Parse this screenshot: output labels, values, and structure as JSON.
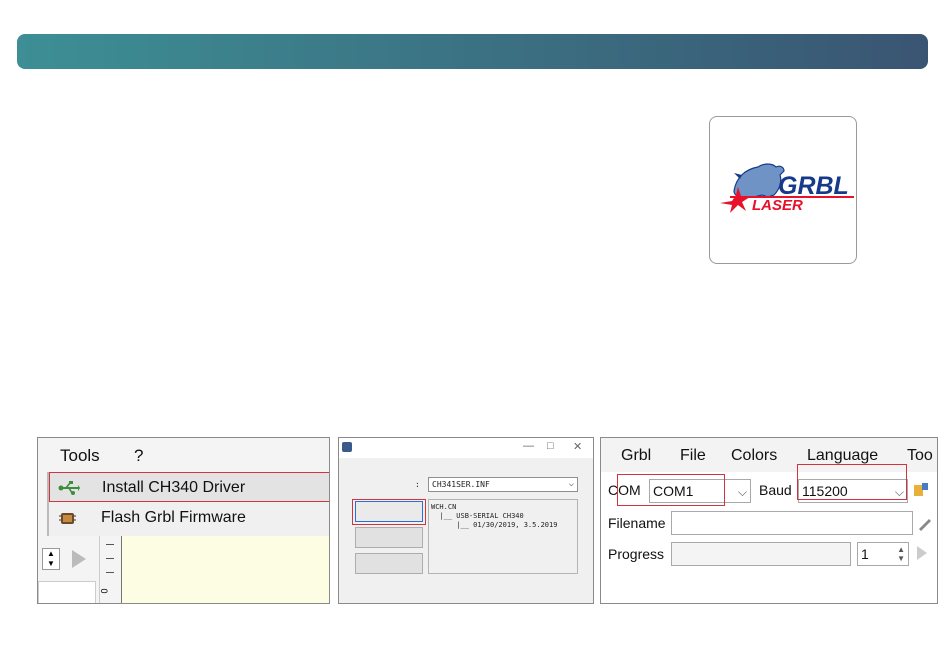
{
  "colors": {
    "header_start": "#3d8f95",
    "header_end": "#3a5573",
    "highlight": "#d0343f",
    "logo_red": "#e8102a",
    "logo_blue": "#163a8a"
  },
  "logo": {
    "text_top": "GRBL",
    "text_bottom": "LASER"
  },
  "panel_menu": {
    "menubar": [
      "Tools",
      "?"
    ],
    "items": [
      {
        "label": "Install CH340 Driver",
        "icon": "usb-icon"
      },
      {
        "label": "Flash Grbl Firmware",
        "icon": "chip-icon"
      }
    ],
    "ruler_label": "0"
  },
  "panel_installer": {
    "window_controls": [
      "—",
      "□",
      "✕"
    ],
    "colon": ":",
    "inf_select": "CH341SER.INF",
    "info_lines": [
      "WCH.CN",
      "  |__ USB-SERIAL CH340",
      "      |__ 01/30/2019, 3.5.2019"
    ]
  },
  "panel_grbl": {
    "menubar": [
      "Grbl",
      "File",
      "Colors",
      "Language",
      "Too"
    ],
    "com_label": "COM",
    "com_value": "COM1",
    "baud_label": "Baud",
    "baud_value": "115200",
    "filename_label": "Filename",
    "progress_label": "Progress",
    "progress_count": "1"
  }
}
